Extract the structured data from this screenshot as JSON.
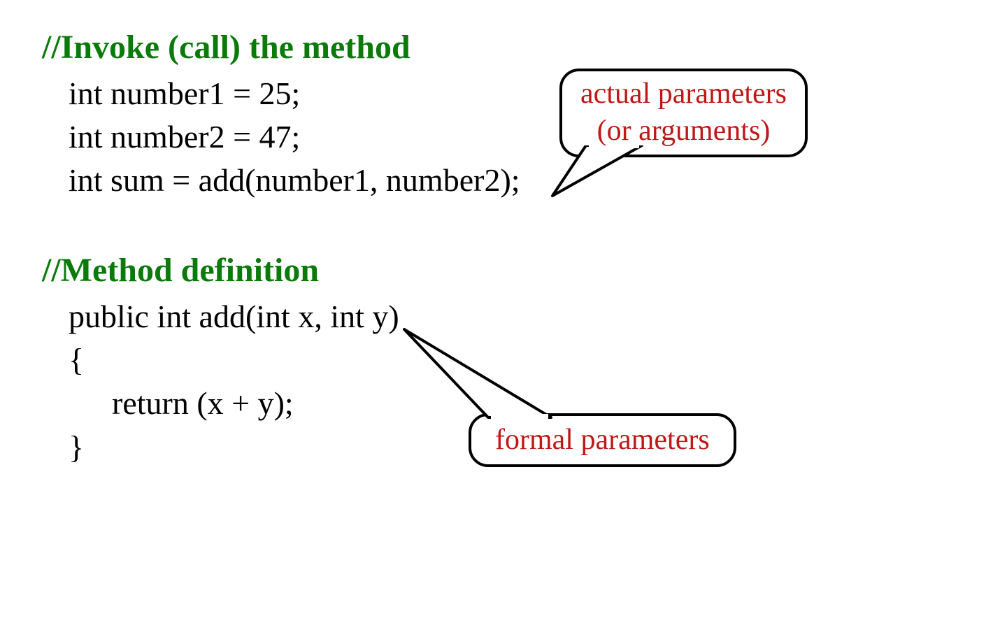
{
  "invoke": {
    "comment": "//Invoke (call) the method",
    "line1": "int number1 = 25;",
    "line2": "int number2 = 47;",
    "line3": "int sum = add(number1, number2);"
  },
  "callout1": {
    "line1": "actual parameters",
    "line2": "(or arguments)"
  },
  "method": {
    "comment": "//Method definition",
    "line1": "public int add(int x, int y)",
    "line2": "{",
    "line3": "return (x + y);",
    "line4": "}"
  },
  "callout2": {
    "text": "formal parameters"
  }
}
